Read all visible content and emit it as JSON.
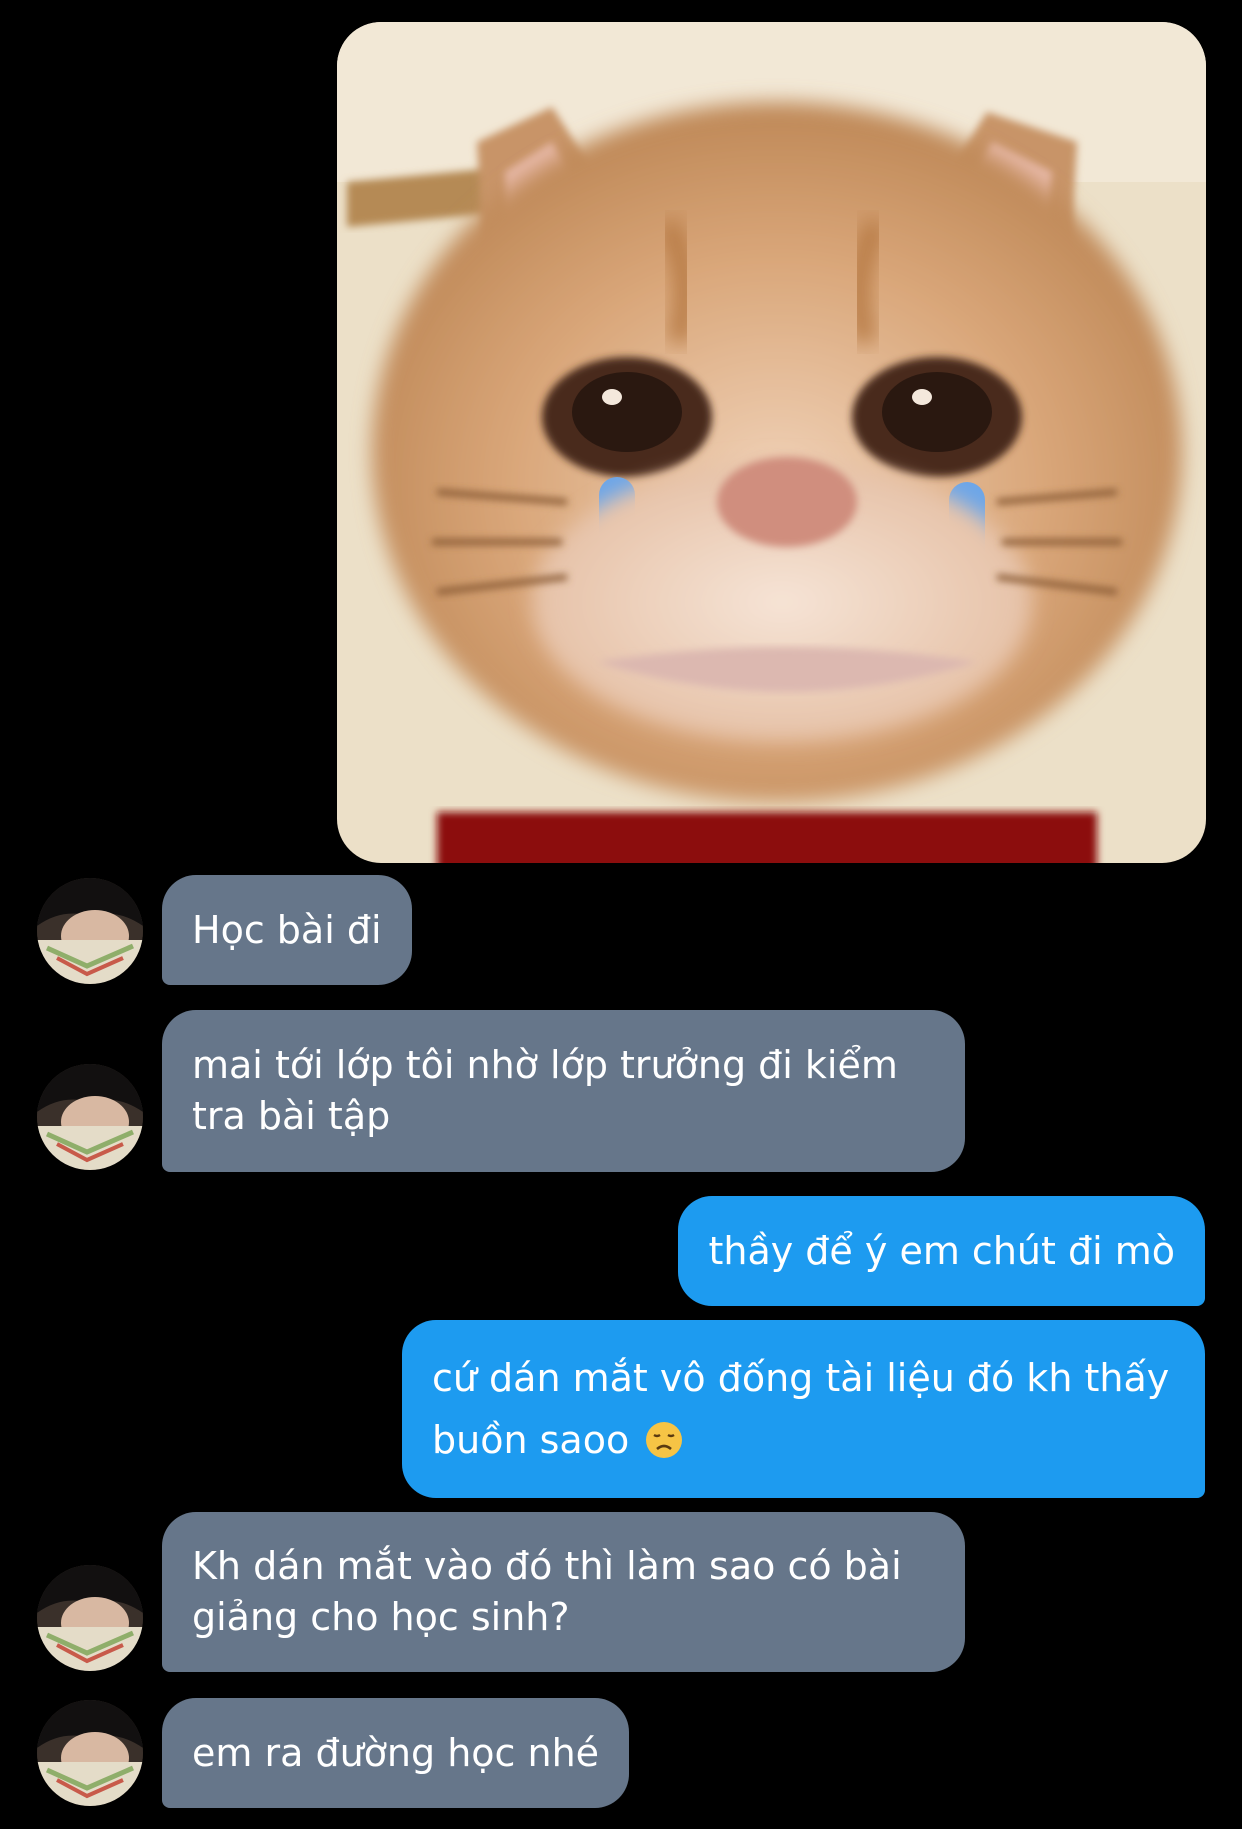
{
  "conversation": {
    "image_message": {
      "icon": "crying-cat-meme-image"
    },
    "messages": [
      {
        "side": "in",
        "text": "Học bài đi"
      },
      {
        "side": "in",
        "text": "mai tới lớp tôi nhờ lớp trưởng đi kiểm tra bài tập"
      },
      {
        "side": "out",
        "text": "thầy để ý em chút đi mò"
      },
      {
        "side": "out",
        "text": "cứ dán mắt vô đống tài liệu đó kh thấy buồn saoo",
        "emoji": "disappointed-face-icon"
      },
      {
        "side": "in",
        "text": "Kh dán mắt vào đó thì làm sao có bài giảng cho học sinh?"
      },
      {
        "side": "in",
        "text": "em ra đường học nhé"
      }
    ],
    "colors": {
      "background": "#000000",
      "incoming_bubble": "#66768a",
      "outgoing_bubble": "#1d9bf0",
      "text": "#ffffff"
    }
  }
}
